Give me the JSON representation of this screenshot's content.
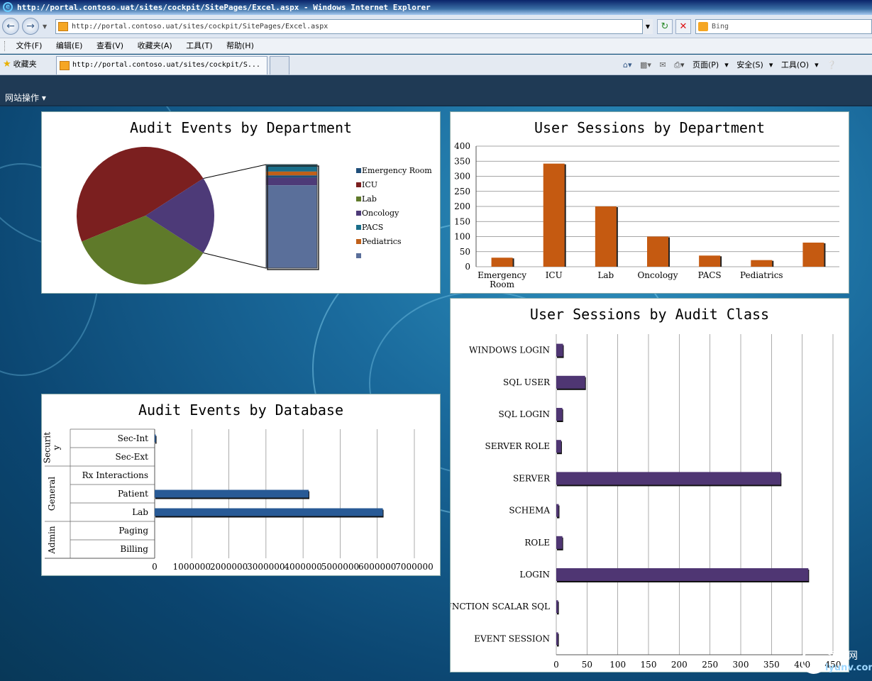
{
  "window": {
    "title": "http://portal.contoso.uat/sites/cockpit/SitePages/Excel.aspx - Windows Internet Explorer"
  },
  "address_bar": {
    "url": "http://portal.contoso.uat/sites/cockpit/SitePages/Excel.aspx",
    "search_placeholder": "Bing"
  },
  "menu": {
    "items": [
      "文件(F)",
      "编辑(E)",
      "查看(V)",
      "收藏夹(A)",
      "工具(T)",
      "帮助(H)"
    ]
  },
  "favorites_bar": {
    "favorites_label": "收藏夹",
    "tab_title": "http://portal.contoso.uat/sites/cockpit/S...",
    "commands": [
      "页面(P)",
      "安全(S)",
      "工具(O)"
    ]
  },
  "sharepoint": {
    "site_actions": "网站操作"
  },
  "chart_data": [
    {
      "type": "pie",
      "title": "Audit Events by Department",
      "categories": [
        "Emergency Room",
        "ICU",
        "Lab",
        "Oncology",
        "PACS",
        "Pediatrics",
        ""
      ],
      "values": [
        35000,
        4200000,
        3100000,
        120000,
        110000,
        60000,
        1300000
      ],
      "colors": [
        "#1f4e79",
        "#7b1f1f",
        "#5f7a2a",
        "#4d3a78",
        "#1a6e8a",
        "#c0601a",
        "#5a6f9a"
      ],
      "legend_position": "right",
      "pie_of_pie": true
    },
    {
      "type": "bar",
      "title": "User Sessions by Department",
      "categories": [
        "Emergency Room",
        "ICU",
        "Lab",
        "Oncology",
        "PACS",
        "Pediatrics",
        ""
      ],
      "values": [
        30,
        342,
        200,
        100,
        37,
        22,
        80
      ],
      "ylim": [
        0,
        400
      ],
      "yticks": [
        0,
        50,
        100,
        150,
        200,
        250,
        300,
        350,
        400
      ],
      "color": "#c55a11",
      "grid": true
    },
    {
      "type": "bar",
      "orientation": "horizontal",
      "title": "User Sessions by Audit Class",
      "categories": [
        "WINDOWS LOGIN",
        "SQL USER",
        "SQL LOGIN",
        "SERVER ROLE",
        "SERVER",
        "SCHEMA",
        "ROLE",
        "LOGIN",
        "FUNCTION SCALAR SQL",
        "EVENT SESSION"
      ],
      "values": [
        11,
        47,
        10,
        8,
        365,
        4,
        10,
        410,
        3,
        3
      ],
      "xlim": [
        0,
        450
      ],
      "xticks": [
        0,
        50,
        100,
        150,
        200,
        250,
        300,
        350,
        400,
        450
      ],
      "color": "#4f3673",
      "grid": true
    },
    {
      "type": "bar",
      "orientation": "horizontal",
      "title": "Audit Events by Database",
      "groups": [
        {
          "name": "Security",
          "label_lines": [
            "Securit",
            "y"
          ],
          "categories": [
            "Sec-Int",
            "Sec-Ext"
          ]
        },
        {
          "name": "General",
          "label_lines": [
            "General"
          ],
          "categories": [
            "Rx Interactions",
            "Patient",
            "Lab"
          ]
        },
        {
          "name": "Admin",
          "label_lines": [
            "Admin"
          ],
          "categories": [
            "Paging",
            "Billing"
          ]
        }
      ],
      "categories": [
        "Sec-Int",
        "Sec-Ext",
        "Rx Interactions",
        "Patient",
        "Lab",
        "Paging",
        "Billing"
      ],
      "values": [
        30000,
        0,
        0,
        4150000,
        6150000,
        0,
        0
      ],
      "xlim": [
        0,
        7000000
      ],
      "xticks": [
        0,
        1000000,
        2000000,
        3000000,
        4000000,
        5000000,
        6000000,
        7000000
      ],
      "color": "#285a96",
      "grid": true
    }
  ],
  "watermark": {
    "cn": "运维网",
    "en": "iyunv.com"
  }
}
